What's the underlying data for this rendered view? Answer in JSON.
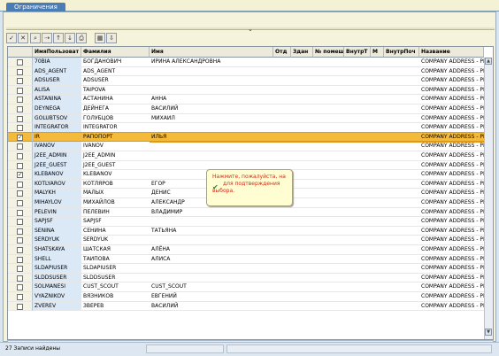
{
  "tabs": [
    {
      "label": "Ограничения"
    }
  ],
  "columns": [
    "ИмяПользоват",
    "Фамилия",
    "Имя",
    "Отд",
    "Здан",
    "№ помещ",
    "ВнутрТ",
    "М",
    "ВнутрПоч",
    "Название"
  ],
  "rows": [
    {
      "id": "70BIA",
      "surname": "БОГДАНОВИЧ",
      "name": "ИРИНА АЛЕКСАНДРОВНА",
      "address": "COMPANY ADDRESS - PLEAS",
      "checked": false,
      "selected": false
    },
    {
      "id": "ADS_AGENT",
      "surname": "ADS_AGENT",
      "name": "",
      "address": "COMPANY ADDRESS - PLEAS",
      "checked": false,
      "selected": false
    },
    {
      "id": "ADSUSER",
      "surname": "ADSUSER",
      "name": "",
      "address": "COMPANY ADDRESS - PLEAS",
      "checked": false,
      "selected": false
    },
    {
      "id": "ALISA",
      "surname": "TAIPOVA",
      "name": "",
      "address": "COMPANY ADDRESS - PLEAS",
      "checked": false,
      "selected": false
    },
    {
      "id": "ASTANINA",
      "surname": "АСТАНИНА",
      "name": "АННА",
      "address": "COMPANY ADDRESS - PLEAS",
      "checked": false,
      "selected": false
    },
    {
      "id": "DEYNEGA",
      "surname": "ДЕЙНЕГА",
      "name": "ВАСИЛИЙ",
      "address": "COMPANY ADDRESS - PLEAS",
      "checked": false,
      "selected": false
    },
    {
      "id": "GOLUBTSOV",
      "surname": "ГОЛУБЦОВ",
      "name": "МИХАИЛ",
      "address": "COMPANY ADDRESS - PLEAS",
      "checked": false,
      "selected": false
    },
    {
      "id": "INTEGRATOR",
      "surname": "INTEGRATOR",
      "name": "",
      "address": "COMPANY ADDRESS - PLEAS",
      "checked": false,
      "selected": false
    },
    {
      "id": "IR",
      "surname": "РАПОПОРТ",
      "name": "ИЛЬЯ",
      "address": "COMPANY ADDRESS - PLEAS",
      "checked": true,
      "selected": true
    },
    {
      "id": "IVANOV",
      "surname": "IVANOV",
      "name": "",
      "address": "COMPANY ADDRESS - PLEAS",
      "checked": false,
      "selected": false
    },
    {
      "id": "J2EE_ADMIN",
      "surname": "J2EE_ADMIN",
      "name": "",
      "address": "COMPANY ADDRESS - PLEAS",
      "checked": false,
      "selected": false
    },
    {
      "id": "J2EE_GUEST",
      "surname": "J2EE_GUEST",
      "name": "",
      "address": "COMPANY ADDRESS - PLEAS",
      "checked": false,
      "selected": false
    },
    {
      "id": "KLEBANOV",
      "surname": "KLEBANOV",
      "name": "",
      "address": "COMPANY ADDRESS - PLEAS",
      "checked": true,
      "selected": false
    },
    {
      "id": "KOTLYAROV",
      "surname": "КОТЛЯРОВ",
      "name": "ЕГОР",
      "address": "COMPANY ADDRESS - PLEAS",
      "checked": false,
      "selected": false
    },
    {
      "id": "MALYKH",
      "surname": "МАЛЫХ",
      "name": "ДЕНИС",
      "address": "COMPANY ADDRESS - PLEAS",
      "checked": false,
      "selected": false
    },
    {
      "id": "MIHAYLOV",
      "surname": "МИХАЙЛОВ",
      "name": "АЛЕКСАНДР",
      "address": "COMPANY ADDRESS - PLEAS",
      "checked": false,
      "selected": false
    },
    {
      "id": "PELEVIN",
      "surname": "ПЕЛЕВИН",
      "name": "ВЛАДИМИР",
      "address": "COMPANY ADDRESS - PLEAS",
      "checked": false,
      "selected": false
    },
    {
      "id": "SAPJSF",
      "surname": "SAPJSF",
      "name": "",
      "address": "COMPANY ADDRESS - PLEAS",
      "checked": false,
      "selected": false
    },
    {
      "id": "SENINA",
      "surname": "СЕНИНА",
      "name": "ТАТЬЯНА",
      "address": "COMPANY ADDRESS - PLEAS",
      "checked": false,
      "selected": false
    },
    {
      "id": "SERDYUK",
      "surname": "SERDYUK",
      "name": "",
      "address": "COMPANY ADDRESS - PLEAS",
      "checked": false,
      "selected": false
    },
    {
      "id": "SHATSKAYA",
      "surname": "ШАТСКАЯ",
      "name": "АЛЁНА",
      "address": "COMPANY ADDRESS - PLEAS",
      "checked": false,
      "selected": false
    },
    {
      "id": "SHELL",
      "surname": "ТАИПОВА",
      "name": "АЛИСА",
      "address": "COMPANY ADDRESS - PLEAS",
      "checked": false,
      "selected": false
    },
    {
      "id": "SLDAPIUSER",
      "surname": "SLDAPIUSER",
      "name": "",
      "address": "COMPANY ADDRESS - PLEAS",
      "checked": false,
      "selected": false
    },
    {
      "id": "SLDDSUSER",
      "surname": "SLDDSUSER",
      "name": "",
      "address": "COMPANY ADDRESS - PLEAS",
      "checked": false,
      "selected": false
    },
    {
      "id": "SOLMANESI",
      "surname": "CUST_SCOUT",
      "name": "CUST_SCOUT",
      "address": "COMPANY ADDRESS - PLEAS",
      "checked": false,
      "selected": false
    },
    {
      "id": "VYAZNIKOV",
      "surname": "ВЯЗНИКОВ",
      "name": "ЕВГЕНИЙ",
      "address": "COMPANY ADDRESS - PLEAS",
      "checked": false,
      "selected": false
    },
    {
      "id": "ZVEREV",
      "surname": "ЗВЕРЕВ",
      "name": "ВАСИЛИЙ",
      "address": "COMPANY ADDRESS - PLEAS",
      "checked": false,
      "selected": false
    }
  ],
  "tooltip": {
    "line1": "Нажмите, пожалуйста, на",
    "line2": "для подтверждения",
    "line3": "выбора."
  },
  "status": {
    "text": "27 Записи найдены"
  },
  "icons": {
    "toolbar": [
      "check-icon",
      "cancel-icon",
      "find-icon",
      "find-next-icon",
      "sort-ascending-icon",
      "sort-descending-icon",
      "print-icon",
      "table-icon",
      "export-icon"
    ]
  }
}
